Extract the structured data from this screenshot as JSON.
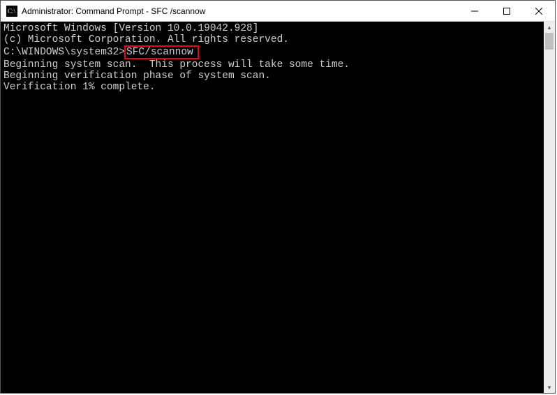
{
  "window": {
    "title": "Administrator: Command Prompt - SFC /scannow"
  },
  "terminal": {
    "line1": "Microsoft Windows [Version 10.0.19042.928]",
    "line2": "(c) Microsoft Corporation. All rights reserved.",
    "blank1": "",
    "prompt_path": "C:\\WINDOWS\\system32>",
    "prompt_cmd": "SFC/scannow",
    "blank2": "",
    "line3": "Beginning system scan.  This process will take some time.",
    "blank3": "",
    "line4": "Beginning verification phase of system scan.",
    "line5": "Verification 1% complete."
  }
}
